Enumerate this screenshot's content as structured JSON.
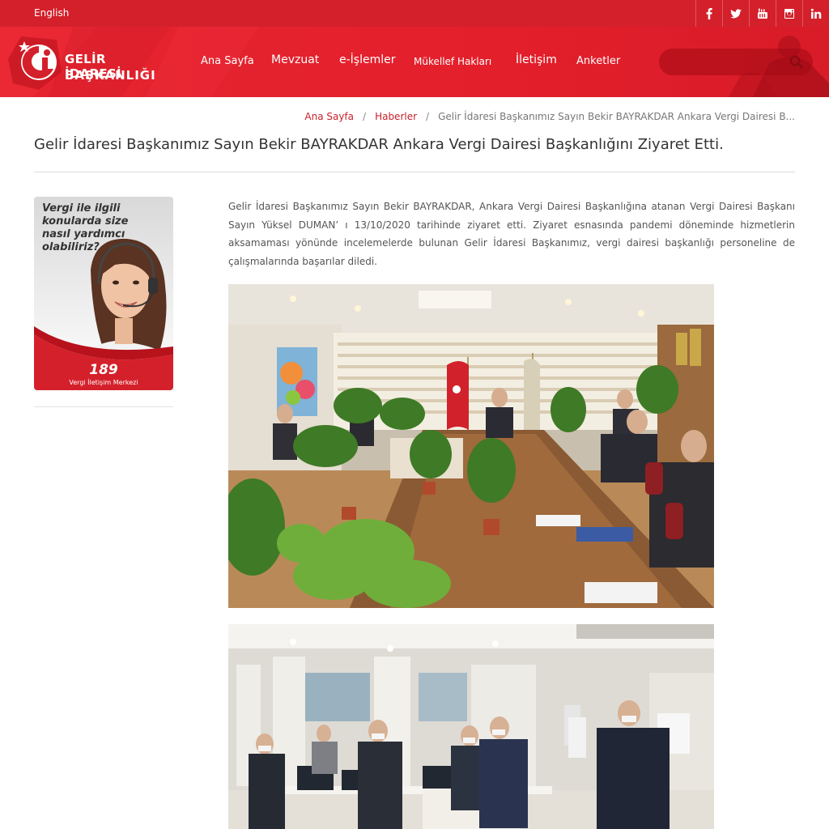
{
  "topbar": {
    "language": "English",
    "social": [
      {
        "icon": "facebook-icon",
        "label": "f"
      },
      {
        "icon": "twitter-icon",
        "label": ""
      },
      {
        "icon": "youtube-icon",
        "label": ""
      },
      {
        "icon": "instagram-icon",
        "label": ""
      },
      {
        "icon": "linkedin-icon",
        "label": "in"
      }
    ]
  },
  "header": {
    "logo_line1": "GELİR İDARESİ",
    "logo_line2": "BAŞKANLIĞI",
    "nav": [
      "Ana Sayfa",
      "Mevzuat",
      "e-İşlemler",
      "Mükellef Hakları",
      "İletişim",
      "Anketler"
    ],
    "search_placeholder": ""
  },
  "breadcrumb": {
    "home": "Ana Sayfa",
    "section": "Haberler",
    "current": "Gelir İdaresi Başkanımız Sayın Bekir BAYRAKDAR Ankara Vergi Dairesi B..."
  },
  "article": {
    "title": "Gelir İdaresi Başkanımız Sayın Bekir BAYRAKDAR Ankara Vergi Dairesi Başkanlığını Ziyaret Etti.",
    "body": "Gelir İdaresi Başkanımız Sayın Bekir BAYRAKDAR, Ankara Vergi Dairesi Başkanlığına atanan Vergi Dairesi Başkanı Sayın Yüksel DUMAN’ ı 13/10/2020 tarihinde ziyaret etti. Ziyaret esnasında pandemi döneminde hizmetlerin aksamaması yönünde incelemelerde bulunan Gelir İdaresi Başkanımız, vergi dairesi başkanlığı personeline de çalışmalarında başarılar diledi."
  },
  "sidebar": {
    "banner_question": "Vergi ile ilgili konularda size nasıl yardımcı olabiliriz?",
    "banner_number": "189",
    "banner_caption": "Vergi İletişim Merkezi"
  },
  "colors": {
    "brand_red": "#d4202b",
    "link_red": "#c8202a",
    "text": "#333333"
  }
}
